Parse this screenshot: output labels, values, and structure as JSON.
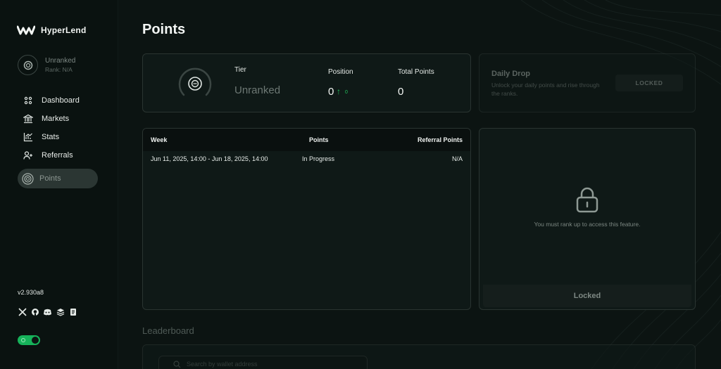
{
  "app": {
    "name": "HyperLend",
    "version": "v2.930a8"
  },
  "user": {
    "tier": "Unranked",
    "rank": "Rank: N/A"
  },
  "nav": {
    "items": [
      {
        "label": "Dashboard",
        "icon": "dashboard-icon"
      },
      {
        "label": "Markets",
        "icon": "bank-icon"
      },
      {
        "label": "Stats",
        "icon": "chart-icon"
      },
      {
        "label": "Referrals",
        "icon": "add-user-icon"
      },
      {
        "label": "Points",
        "icon": "rank-badge-icon",
        "active": true
      }
    ]
  },
  "socials": [
    "x-icon",
    "github-icon",
    "discord-icon",
    "stack-icon",
    "book-icon"
  ],
  "page": {
    "title": "Points"
  },
  "tier_card": {
    "tier_label": "Tier",
    "tier_value": "Unranked",
    "position_label": "Position",
    "position_value": "0",
    "position_change": "0",
    "total_label": "Total Points",
    "total_value": "0"
  },
  "daily_drop": {
    "title": "Daily Drop",
    "subtitle": "Unlock your daily points and rise through the ranks.",
    "button": "LOCKED"
  },
  "weeks_table": {
    "columns": [
      "Week",
      "Points",
      "Referral Points"
    ],
    "rows": [
      {
        "week": "Jun 11, 2025, 14:00 - Jun 18, 2025, 14:00",
        "points": "In Progress",
        "referral": "N/A"
      }
    ]
  },
  "locked_panel": {
    "message": "You must rank up to access this feature.",
    "footer": "Locked"
  },
  "leaderboard": {
    "title": "Leaderboard",
    "search_placeholder": "Search by wallet address"
  },
  "colors": {
    "accent": "#22c55e",
    "background": "#0c1412",
    "card": "#0f1917",
    "border": "#2a3431"
  }
}
